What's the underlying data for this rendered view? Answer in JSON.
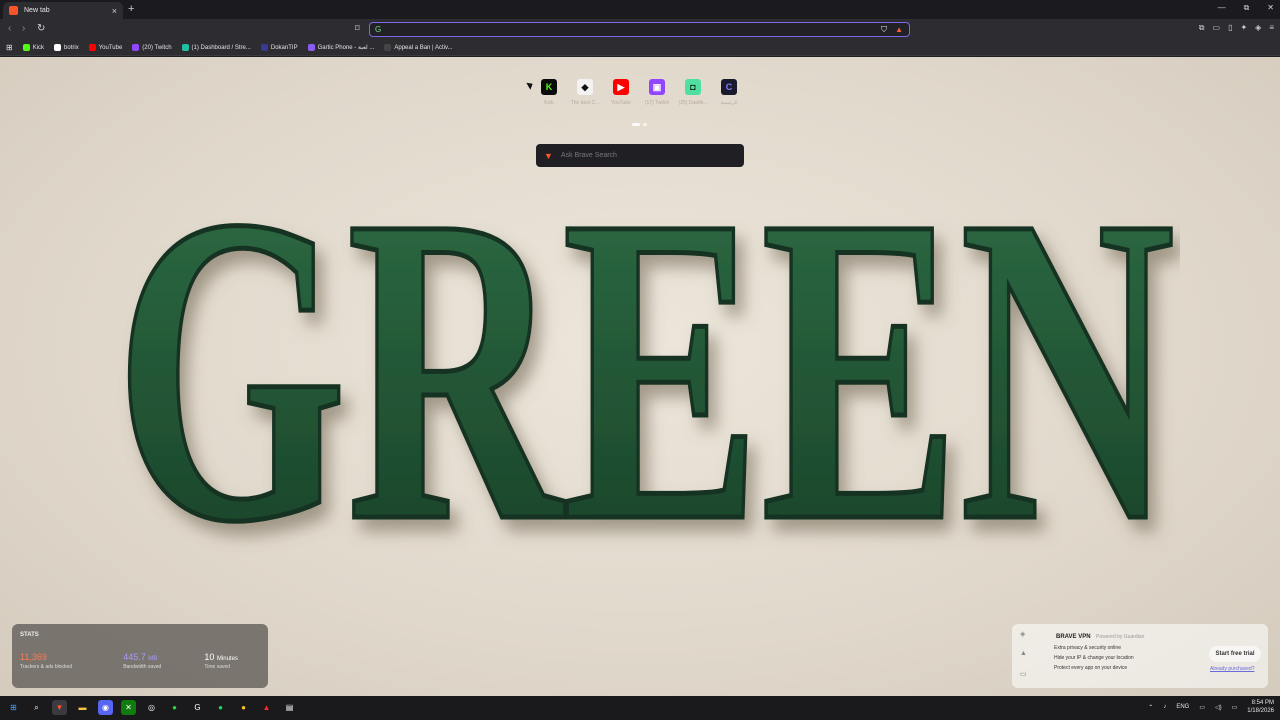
{
  "browser": {
    "tab_title": "New tab",
    "tab_close": "×",
    "new_tab": "+",
    "window_buttons": [
      "—",
      "⧉",
      "✕"
    ]
  },
  "bookmarks": [
    {
      "label": "Kick",
      "color": "#53fc18"
    },
    {
      "label": "botrix",
      "color": "#ffffff"
    },
    {
      "label": "YouTube",
      "color": "#ff0000"
    },
    {
      "label": "(20) Twitch",
      "color": "#9146ff"
    },
    {
      "label": "(1) Dashboard / Stre...",
      "color": "#1fbfa0"
    },
    {
      "label": "DokanTIP",
      "color": "#3a3a90"
    },
    {
      "label": "Gartic Phone - لعبة ...",
      "color": "#8a5cf0"
    },
    {
      "label": "Appeal a Ban | Activ...",
      "color": "#444"
    }
  ],
  "top_sites": [
    {
      "label": "Kick",
      "icon": "K",
      "bg": "#0b0b0b",
      "fg": "#53fc18"
    },
    {
      "label": "The best C...",
      "icon": "◆",
      "bg": "#f2f2f2",
      "fg": "#111"
    },
    {
      "label": "YouTube",
      "icon": "▶",
      "bg": "#ff0000",
      "fg": "#fff"
    },
    {
      "label": "(17) Twitch",
      "icon": "▣",
      "bg": "#9146ff",
      "fg": "#fff"
    },
    {
      "label": "(25) Dashb...",
      "icon": "◘",
      "bg": "#4de0a0",
      "fg": "#111"
    },
    {
      "label": "الرئيسية",
      "icon": "C",
      "bg": "#1a1a2e",
      "fg": "#8a7cff"
    }
  ],
  "search": {
    "placeholder": "Ask Brave Search"
  },
  "hero": {
    "text": "GREEN",
    "color": "#1f5a34"
  },
  "stats": {
    "heading": "STATS",
    "trackers_value": "11,369",
    "trackers_label": "Trackers & ads blocked",
    "bandwidth_value": "445.7",
    "bandwidth_unit": "MB",
    "bandwidth_label": "Bandwidth saved",
    "time_value": "10",
    "time_unit": "Minutes",
    "time_label": "Time saved"
  },
  "vpn": {
    "title": "BRAVE VPN",
    "powered": "Powered by Guardian",
    "features": [
      "Extra privacy & security online",
      "Hide your IP & change your location",
      "Protect every app on your device"
    ],
    "cta": "Start free trial",
    "link": "Already purchased?"
  },
  "tray": {
    "lang": "ENG",
    "time": "8:54 PM",
    "date": "1/18/2026"
  }
}
